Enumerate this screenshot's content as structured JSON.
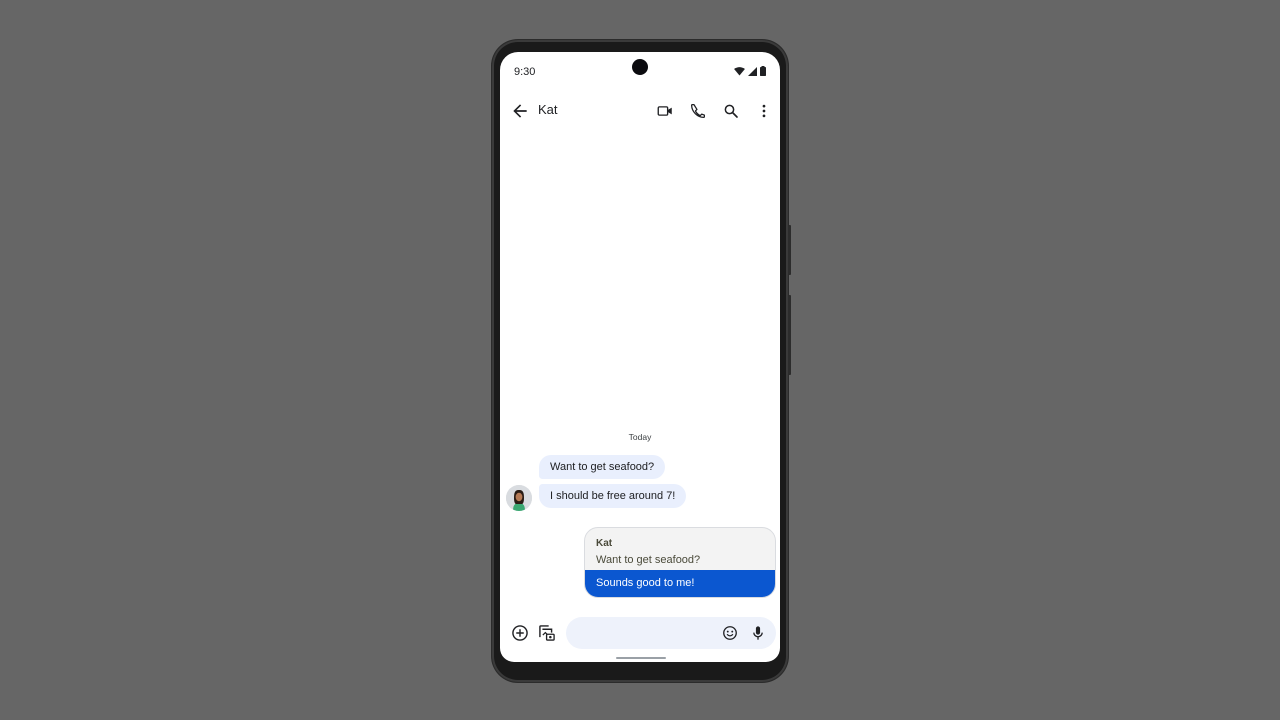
{
  "status_bar": {
    "time": "9:30",
    "icons": [
      "wifi-icon",
      "signal-icon",
      "battery-icon"
    ]
  },
  "top_bar": {
    "back_icon": "arrow-back-icon",
    "title": "Kat",
    "actions": [
      {
        "name": "video-call",
        "icon": "video-camera-icon"
      },
      {
        "name": "voice-call",
        "icon": "phone-icon"
      },
      {
        "name": "search",
        "icon": "search-icon"
      },
      {
        "name": "more-options",
        "icon": "more-vert-icon"
      }
    ]
  },
  "conversation": {
    "date_divider": "Today",
    "incoming": [
      {
        "sender": "Kat",
        "text": "Want to get seafood?"
      },
      {
        "sender": "Kat",
        "text": "I should be free around 7!"
      }
    ],
    "outgoing_reply": {
      "quoted_sender": "Kat",
      "quoted_text": "Want to get seafood?",
      "text": "Sounds good to me!"
    }
  },
  "compose": {
    "input_value": "",
    "placeholder": "",
    "left_buttons": [
      "add-icon",
      "gallery-icon"
    ],
    "right_buttons": [
      "emoji-icon",
      "microphone-icon"
    ]
  },
  "colors": {
    "background": "#666666",
    "incoming_bubble": "#e9effd",
    "outgoing_bubble": "#0b57d0",
    "compose_pill": "#eef2fb"
  }
}
